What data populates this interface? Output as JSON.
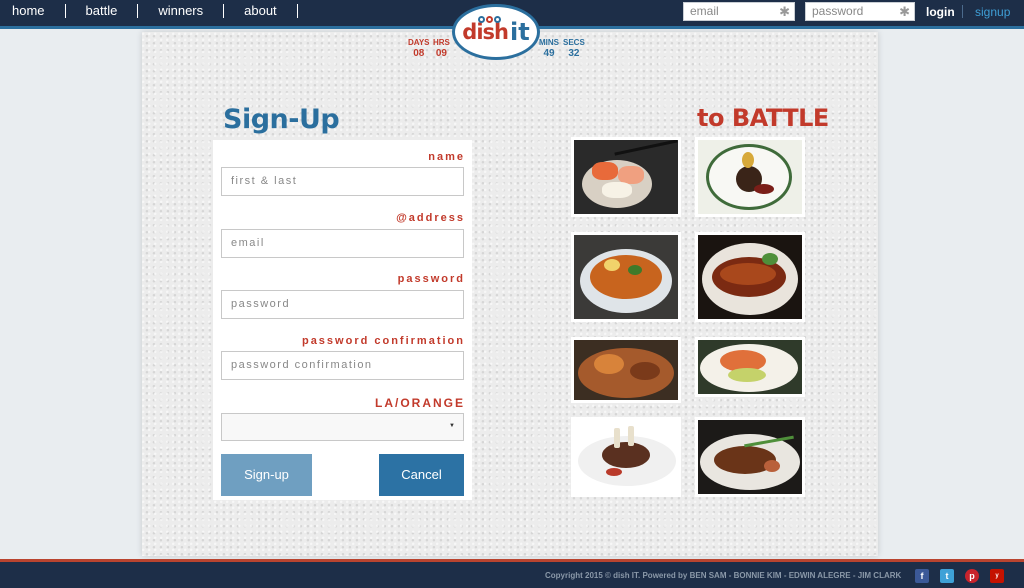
{
  "nav": {
    "items": [
      {
        "label": "home"
      },
      {
        "label": "battle"
      },
      {
        "label": "winners"
      },
      {
        "label": "about"
      }
    ]
  },
  "auth": {
    "email_placeholder": "email",
    "password_placeholder": "password",
    "login_label": "login",
    "signup_label": "signup"
  },
  "logo": {
    "dish": "dish",
    "it": "it"
  },
  "countdown": {
    "days_label": "DAYS",
    "days": "08",
    "hrs_label": "HRS",
    "hrs": "09",
    "mins_label": "MINS",
    "mins": "49",
    "secs_label": "SECS",
    "secs": "32"
  },
  "signup": {
    "title": "Sign-Up",
    "name_label": "name",
    "name_placeholder": "first & last",
    "address_label": "@address",
    "email_placeholder": "email",
    "password_label": "password",
    "password_placeholder": "password",
    "confirm_label": "password confirmation",
    "confirm_placeholder": "password confirmation",
    "region_label": "LA/ORANGE",
    "region_value": "",
    "submit_label": "Sign-up",
    "cancel_label": "Cancel"
  },
  "battle": {
    "title": "to BATTLE"
  },
  "footer": {
    "copyright": "Copyright 2015 © dish IT. Powered by BEN SAM - BONNIE KIM - EDWIN ALEGRE - JIM CLARK",
    "social": [
      "facebook",
      "twitter",
      "pinterest",
      "yelp"
    ]
  },
  "colors": {
    "navy": "#1d2e48",
    "brand_blue": "#2b6f9e",
    "brand_red": "#c23a2b"
  }
}
